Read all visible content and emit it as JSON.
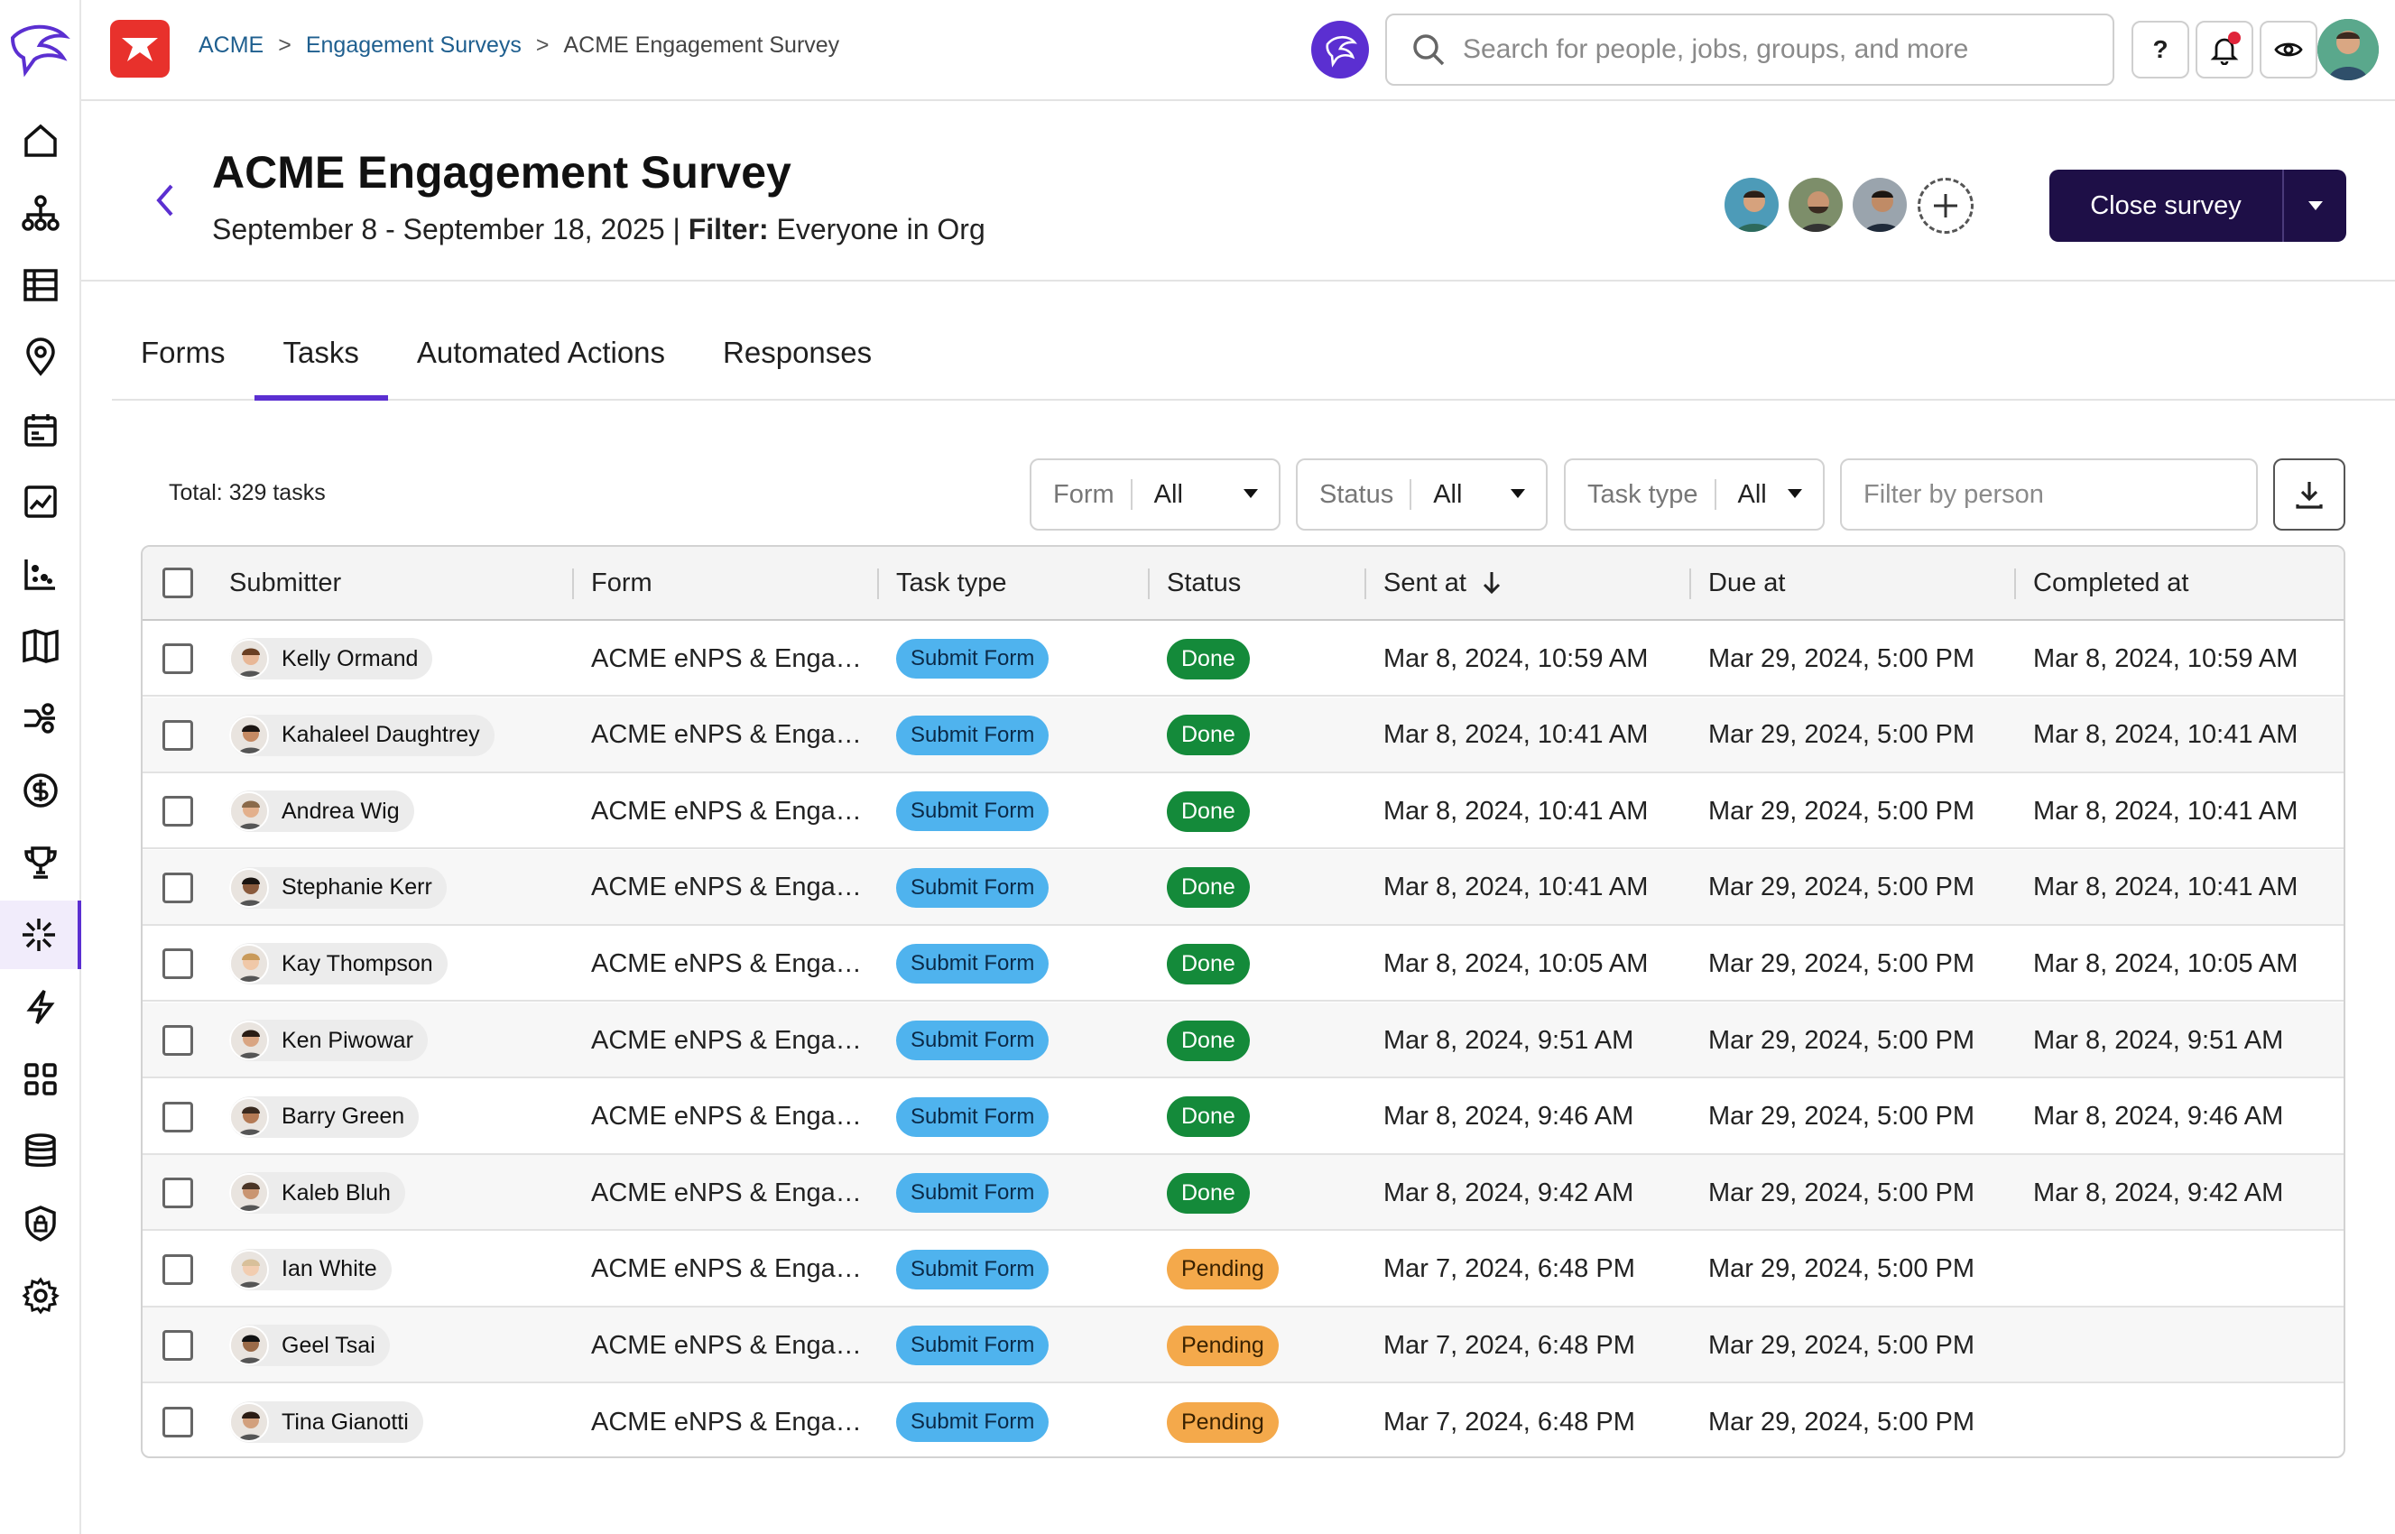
{
  "breadcrumb": {
    "root": "ACME",
    "section": "Engagement Surveys",
    "current": "ACME Engagement Survey",
    "separator": ">"
  },
  "search": {
    "placeholder": "Search for people, jobs, groups, and more"
  },
  "topbar": {
    "help_label": "?"
  },
  "header": {
    "title": "ACME Engagement Survey",
    "date_range": "September 8 - September 18, 2025 |",
    "filter_label": "Filter:",
    "filter_value": "Everyone in Org",
    "close_label": "Close survey"
  },
  "tabs": [
    {
      "label": "Forms",
      "active": false
    },
    {
      "label": "Tasks",
      "active": true
    },
    {
      "label": "Automated Actions",
      "active": false
    },
    {
      "label": "Responses",
      "active": false
    }
  ],
  "filters": {
    "total": "Total: 329 tasks",
    "form": {
      "label": "Form",
      "value": "All"
    },
    "status": {
      "label": "Status",
      "value": "All"
    },
    "task_type": {
      "label": "Task type",
      "value": "All"
    },
    "person_placeholder": "Filter by person"
  },
  "table": {
    "columns": [
      "Submitter",
      "Form",
      "Task type",
      "Status",
      "Sent at",
      "Due at",
      "Completed at"
    ],
    "rows": [
      {
        "submitter": "Kelly Ormand",
        "form": "ACME eNPS & Engag…",
        "task_type": "Submit Form",
        "status": "Done",
        "sent": "Mar 8, 2024, 10:59 AM",
        "due": "Mar 29, 2024, 5:00 PM",
        "completed": "Mar 8, 2024, 10:59 AM"
      },
      {
        "submitter": "Kahaleel Daughtrey",
        "form": "ACME eNPS & Engag…",
        "task_type": "Submit Form",
        "status": "Done",
        "sent": "Mar 8, 2024, 10:41 AM",
        "due": "Mar 29, 2024, 5:00 PM",
        "completed": "Mar 8, 2024, 10:41 AM"
      },
      {
        "submitter": "Andrea Wig",
        "form": "ACME eNPS & Engag…",
        "task_type": "Submit Form",
        "status": "Done",
        "sent": "Mar 8, 2024, 10:41 AM",
        "due": "Mar 29, 2024, 5:00 PM",
        "completed": "Mar 8, 2024, 10:41 AM"
      },
      {
        "submitter": "Stephanie Kerr",
        "form": "ACME eNPS & Engag…",
        "task_type": "Submit Form",
        "status": "Done",
        "sent": "Mar 8, 2024, 10:41 AM",
        "due": "Mar 29, 2024, 5:00 PM",
        "completed": "Mar 8, 2024, 10:41 AM"
      },
      {
        "submitter": "Kay Thompson",
        "form": "ACME eNPS & Engag…",
        "task_type": "Submit Form",
        "status": "Done",
        "sent": "Mar 8, 2024, 10:05 AM",
        "due": "Mar 29, 2024, 5:00 PM",
        "completed": "Mar 8, 2024, 10:05 AM"
      },
      {
        "submitter": "Ken Piwowar",
        "form": "ACME eNPS & Engag…",
        "task_type": "Submit Form",
        "status": "Done",
        "sent": "Mar 8, 2024, 9:51 AM",
        "due": "Mar 29, 2024, 5:00 PM",
        "completed": "Mar 8, 2024, 9:51 AM"
      },
      {
        "submitter": "Barry Green",
        "form": "ACME eNPS & Engag…",
        "task_type": "Submit Form",
        "status": "Done",
        "sent": "Mar 8, 2024, 9:46 AM",
        "due": "Mar 29, 2024, 5:00 PM",
        "completed": "Mar 8, 2024, 9:46 AM"
      },
      {
        "submitter": "Kaleb Bluh",
        "form": "ACME eNPS & Engag…",
        "task_type": "Submit Form",
        "status": "Done",
        "sent": "Mar 8, 2024, 9:42 AM",
        "due": "Mar 29, 2024, 5:00 PM",
        "completed": "Mar 8, 2024, 9:42 AM"
      },
      {
        "submitter": "Ian White",
        "form": "ACME eNPS & Engag…",
        "task_type": "Submit Form",
        "status": "Pending",
        "sent": "Mar 7, 2024, 6:48 PM",
        "due": "Mar 29, 2024, 5:00 PM",
        "completed": ""
      },
      {
        "submitter": "Geel Tsai",
        "form": "ACME eNPS & Engag…",
        "task_type": "Submit Form",
        "status": "Pending",
        "sent": "Mar 7, 2024, 6:48 PM",
        "due": "Mar 29, 2024, 5:00 PM",
        "completed": ""
      },
      {
        "submitter": "Tina Gianotti",
        "form": "ACME eNPS & Engag…",
        "task_type": "Submit Form",
        "status": "Pending",
        "sent": "Mar 7, 2024, 6:48 PM",
        "due": "Mar 29, 2024, 5:00 PM",
        "completed": ""
      }
    ]
  },
  "colors": {
    "accent": "#5b2fd1",
    "primary_button": "#1e0f47",
    "task_pill": "#4fb3ee",
    "done": "#148a3a",
    "pending": "#f4a94b",
    "brand_red": "#e8312c"
  }
}
